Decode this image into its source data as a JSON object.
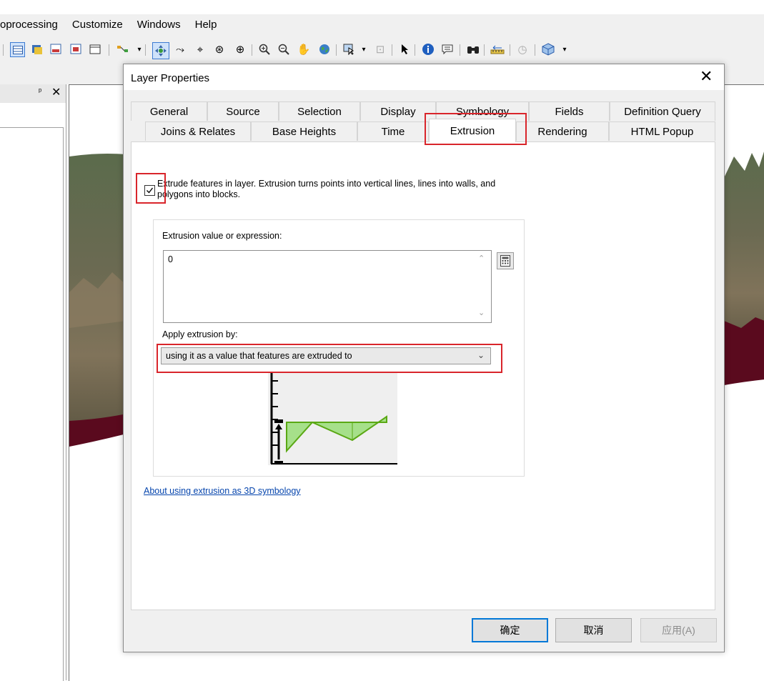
{
  "menu": [
    "oprocessing",
    "Customize",
    "Windows",
    "Help"
  ],
  "toolbar_icons": [
    "table-icon",
    "python-icon",
    "report-icon",
    "toolbox-icon",
    "window-icon",
    "model-icon",
    "pan-icon",
    "fly-icon",
    "zoom-center-icon",
    "target-zoom-icon",
    "zoom-extent-icon",
    "zoom-in-icon",
    "zoom-out-icon",
    "hand-icon",
    "globe-icon",
    "select-features-icon",
    "clear-selection-icon",
    "arrow-icon",
    "identify-icon",
    "html-popup-icon",
    "find-icon",
    "measure-icon",
    "time-slider-icon",
    "3d-effects-icon"
  ],
  "left_panel": {
    "pin": "ᵖ",
    "close": "✕"
  },
  "dialog": {
    "title": "Layer Properties",
    "close": "✕",
    "tabs_row1": [
      "General",
      "Source",
      "Selection",
      "Display",
      "Symbology",
      "Fields",
      "Definition Query"
    ],
    "tabs_row2": [
      "Joins & Relates",
      "Base Heights",
      "Time",
      "Extrusion",
      "Rendering",
      "HTML Popup"
    ],
    "active_tab": "Extrusion",
    "extrude_checked": true,
    "extrude_label": "Extrude features in layer.  Extrusion turns points into vertical lines, lines into walls, and polygons into blocks.",
    "expression_label": "Extrusion value or expression:",
    "expression_value": "0",
    "apply_label": "Apply extrusion by:",
    "apply_value": "using it as a value that features are extruded to",
    "help_link": "About using extrusion as 3D symbology",
    "buttons": {
      "ok": "确定",
      "cancel": "取消",
      "apply": "应用(A)"
    }
  },
  "colors": {
    "highlight_red": "#d9252b",
    "diagram_green": "#5aa814",
    "terrain_base": "#5a0a1e"
  }
}
